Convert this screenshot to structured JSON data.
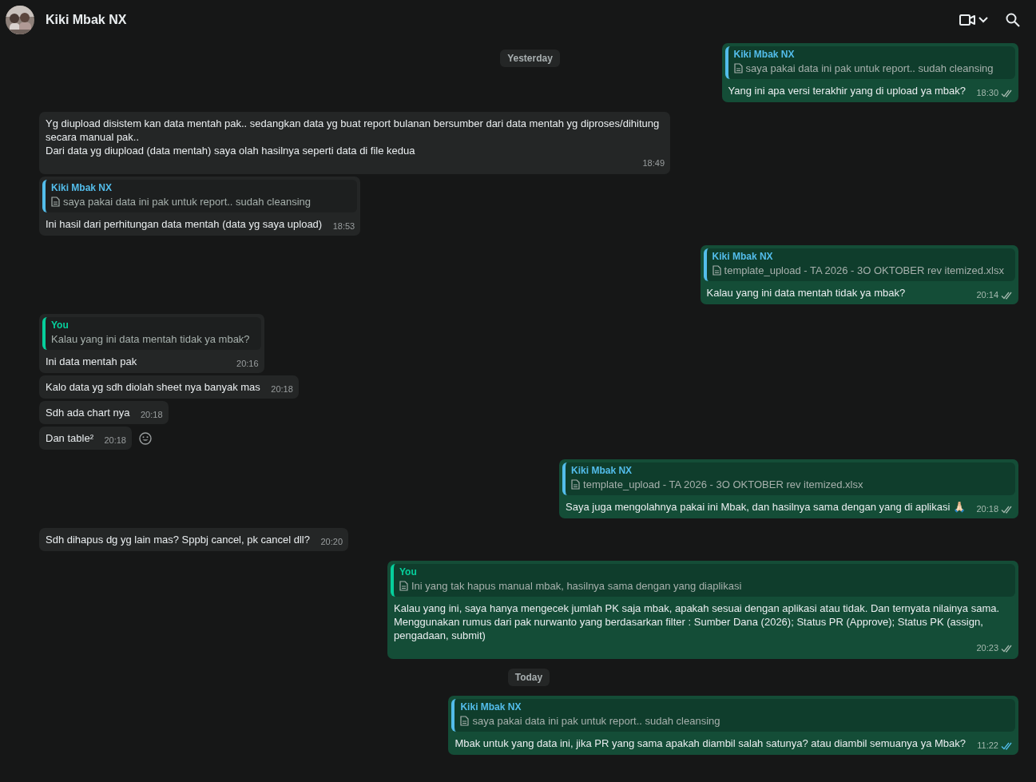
{
  "header": {
    "contact_name": "Kiki Mbak NX"
  },
  "sticky_date": "Yesterday",
  "messages": [
    {
      "kind": "out",
      "quote": {
        "author": "Kiki Mbak NX",
        "from_me": false,
        "file": true,
        "text": "saya pakai data ini pak untuk report.. sudah cleansing"
      },
      "text": "Yang ini apa versi terakhir yang di upload ya mbak?",
      "time": "18:30",
      "read": false
    },
    {
      "kind": "in",
      "text": "Yg diupload disistem kan data mentah pak.. sedangkan data yg buat report bulanan bersumber dari data mentah yg diproses/dihitung secara manual pak..\nDari data yg diupload (data mentah) saya olah hasilnya seperti data di file kedua",
      "time": "18:49"
    },
    {
      "kind": "in",
      "quote": {
        "author": "Kiki Mbak NX",
        "from_me": false,
        "file": true,
        "text": "saya pakai data ini pak untuk report.. sudah cleansing"
      },
      "text": "Ini hasil dari perhitungan data mentah (data yg saya upload)",
      "time": "18:53"
    },
    {
      "kind": "out",
      "quote": {
        "author": "Kiki Mbak NX",
        "from_me": false,
        "file": true,
        "text": "template_upload - TA 2026 - 3O OKTOBER rev itemized.xlsx"
      },
      "text": "Kalau yang ini data mentah tidak ya mbak?",
      "time": "20:14",
      "read": false
    },
    {
      "kind": "in",
      "quote": {
        "author": "You",
        "from_me": true,
        "file": false,
        "text": "Kalau yang ini data mentah tidak ya mbak?"
      },
      "text": "Ini data mentah pak",
      "time": "20:16"
    },
    {
      "kind": "in",
      "text": "Kalo data yg sdh diolah sheet nya banyak mas",
      "time": "20:18"
    },
    {
      "kind": "in",
      "text": "Sdh ada chart nya",
      "time": "20:18"
    },
    {
      "kind": "in",
      "text": "Dan table²",
      "time": "20:18",
      "react_button": true
    },
    {
      "kind": "out",
      "quote": {
        "author": "Kiki Mbak NX",
        "from_me": false,
        "file": true,
        "text": "template_upload - TA 2026 - 3O OKTOBER rev itemized.xlsx"
      },
      "text": "Saya juga mengolahnya pakai ini Mbak, dan hasilnya sama dengan yang di aplikasi 🙏🏻",
      "time": "20:18",
      "read": false
    },
    {
      "kind": "in",
      "text": "Sdh dihapus dg yg lain mas? Sppbj cancel, pk cancel dll?",
      "time": "20:20"
    },
    {
      "kind": "out",
      "quote": {
        "author": "You",
        "from_me": true,
        "file": true,
        "text": "Ini yang tak hapus manual mbak, hasilnya sama dengan yang diaplikasi"
      },
      "text": "Kalau yang ini, saya hanya mengecek jumlah PK saja mbak, apakah sesuai dengan aplikasi atau tidak. Dan ternyata nilainya sama.\nMenggunakan rumus dari pak nurwanto yang berdasarkan filter : Sumber Dana (2026); Status PR (Approve); Status PK (assign, pengadaan, submit)",
      "time": "20:23",
      "read": false
    },
    {
      "kind": "date",
      "text": "Today"
    },
    {
      "kind": "out",
      "quote": {
        "author": "Kiki Mbak NX",
        "from_me": false,
        "file": true,
        "text": "saya pakai data ini pak untuk report.. sudah cleansing"
      },
      "text": "Mbak untuk yang data ini, jika PR yang sama apakah diambil salah satunya? atau diambil semuanya ya Mbak?",
      "time": "11:22",
      "read": true
    }
  ]
}
